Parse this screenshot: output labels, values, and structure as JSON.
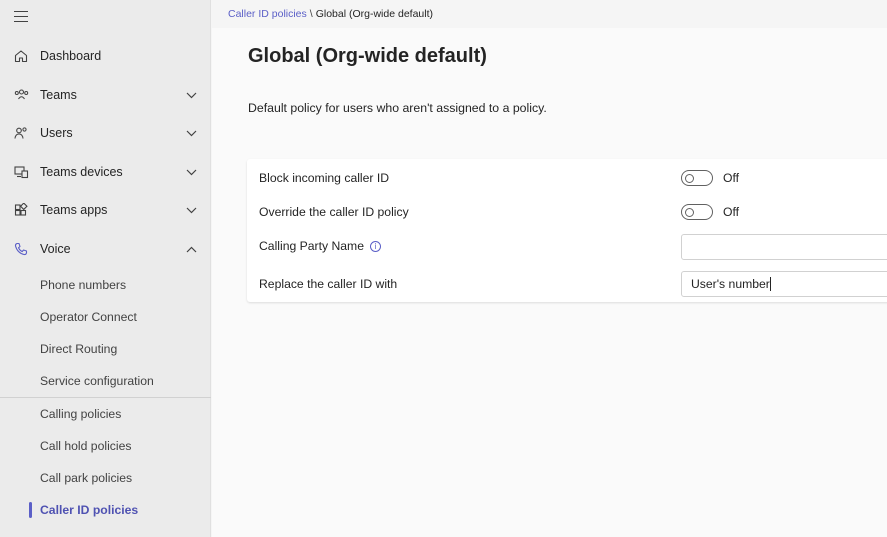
{
  "sidebar": {
    "nav": [
      {
        "label": "Dashboard",
        "icon": "home-icon"
      },
      {
        "label": "Teams",
        "icon": "teams-icon"
      },
      {
        "label": "Users",
        "icon": "users-icon"
      },
      {
        "label": "Teams devices",
        "icon": "devices-icon"
      },
      {
        "label": "Teams apps",
        "icon": "apps-icon"
      },
      {
        "label": "Voice",
        "icon": "phone-icon"
      }
    ],
    "voice_items": [
      "Phone numbers",
      "Operator Connect",
      "Direct Routing",
      "Service configuration",
      "Calling policies",
      "Call hold policies",
      "Call park policies",
      "Caller ID policies"
    ],
    "active_item": "Caller ID policies"
  },
  "breadcrumb": {
    "parent": "Caller ID policies",
    "separator": "\\",
    "current": "Global (Org-wide default)"
  },
  "main": {
    "title": "Global (Org-wide default)",
    "description": "Default policy for users who aren't assigned to a policy.",
    "settings": {
      "block_label": "Block incoming caller ID",
      "block_state": "Off",
      "override_label": "Override the caller ID policy",
      "override_state": "Off",
      "calling_party_label": "Calling Party Name",
      "calling_party_value": "",
      "replace_label": "Replace the caller ID with",
      "replace_value": "User's number"
    }
  },
  "colors": {
    "accent": "#5b5fc7",
    "sidebar_bg": "#ebebeb",
    "content_bg": "#fafafa"
  }
}
